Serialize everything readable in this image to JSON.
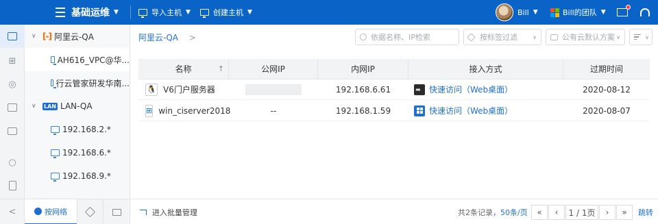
{
  "header": {
    "title": "基础运维",
    "import_label": "导入主机",
    "create_label": "创建主机",
    "user_name": "Bill",
    "team_name": "Bill的团队",
    "brand_color": "#0a64c8"
  },
  "rail": {
    "icons": [
      "monitor-icon",
      "network-icon",
      "database-icon",
      "cloud-storage-icon",
      "file-icon",
      "search-icon",
      "clipboard-icon"
    ],
    "collapse_glyph": "<"
  },
  "tree": {
    "items": [
      {
        "label": "阿里云-QA",
        "type": "aliyun-group",
        "expanded": true
      },
      {
        "label": "AH616_VPC@华...",
        "type": "vpc"
      },
      {
        "label": "行云管家研发华南...",
        "type": "vpc"
      },
      {
        "label": "LAN-QA",
        "type": "lan-group",
        "expanded": true
      },
      {
        "label": "192.168.2.*",
        "type": "subnet"
      },
      {
        "label": "192.168.6.*",
        "type": "subnet"
      },
      {
        "label": "192.168.9.*",
        "type": "subnet"
      }
    ],
    "aliyun_logo": "[-]",
    "lan_badge": "LAN",
    "tabs": [
      {
        "label": "按网络",
        "active": true
      },
      {
        "label": "",
        "icon": "tag-icon"
      },
      {
        "label": "",
        "icon": "folder-icon"
      }
    ]
  },
  "main": {
    "breadcrumb": "阿里云-QA",
    "breadcrumb_sep": ">",
    "search_placeholder": "依据名称、IP检索",
    "tag_filter_placeholder": "按标签过滤",
    "cloud_plan_placeholder": "公有云默认方案"
  },
  "table": {
    "columns": [
      "名称",
      "公网IP",
      "内网IP",
      "接入方式",
      "过期时间"
    ],
    "sort_indicator": "↑",
    "rows": [
      {
        "os": "linux",
        "os_glyph": "🐧",
        "name": "V6门户服务器",
        "public_ip": "",
        "private_ip": "192.168.6.61",
        "access": "快速访问（Web桌面）",
        "expires": "2020-08-12"
      },
      {
        "os": "windows",
        "os_glyph": "⊞",
        "name": "win_ciserver2018",
        "public_ip": "--",
        "private_ip": "192.168.1.59",
        "access": "快速访问（Web桌面）",
        "expires": "2020-08-07"
      }
    ]
  },
  "footer": {
    "batch_label": "进入批量管理",
    "total_text": "共2条记录，",
    "page_size": "50条/页",
    "first": "«",
    "prev": "‹",
    "page_indicator": "1 / 1页",
    "next": "›",
    "last": "»",
    "jump": "跳转"
  }
}
